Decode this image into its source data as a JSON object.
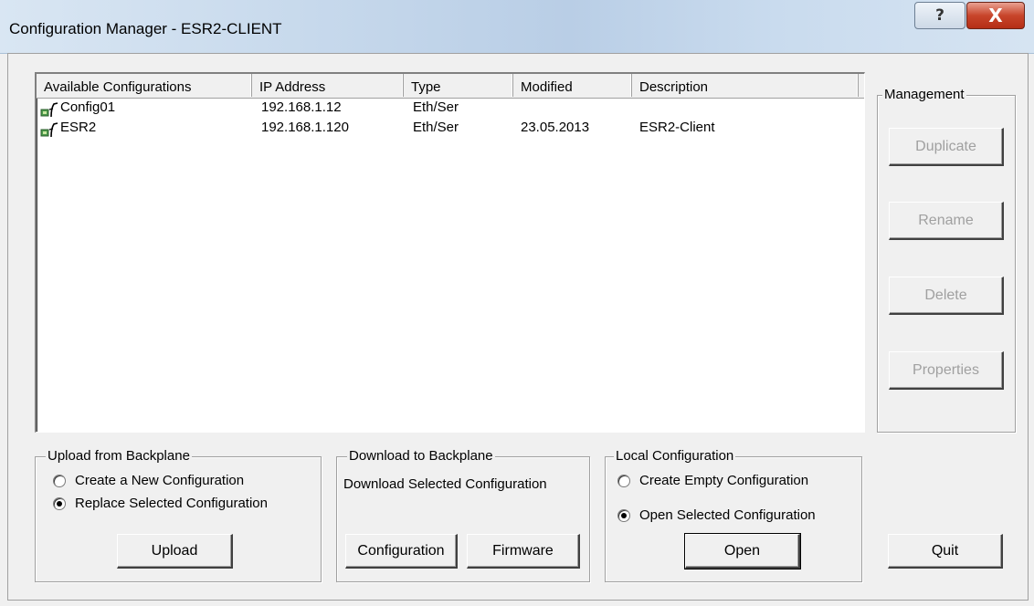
{
  "window": {
    "title": "Configuration Manager - ESR2-CLIENT",
    "help_label": "?",
    "close_label": "X"
  },
  "list": {
    "columns": [
      "Available Configurations",
      "IP Address",
      "Type",
      "Modified",
      "Description"
    ],
    "rows": [
      {
        "name": "Config01",
        "ip": "192.168.1.12",
        "type": "Eth/Ser",
        "modified": "",
        "description": ""
      },
      {
        "name": "ESR2",
        "ip": "192.168.1.120",
        "type": "Eth/Ser",
        "modified": "23.05.2013",
        "description": "ESR2-Client"
      }
    ]
  },
  "management": {
    "legend": "Management",
    "duplicate": "Duplicate",
    "rename": "Rename",
    "delete": "Delete",
    "properties": "Properties"
  },
  "upload": {
    "legend": "Upload from Backplane",
    "option_new": "Create a New Configuration",
    "option_replace": "Replace Selected Configuration",
    "button": "Upload"
  },
  "download": {
    "legend": "Download to Backplane",
    "text": "Download Selected Configuration",
    "config_button": "Configuration",
    "firmware_button": "Firmware"
  },
  "local": {
    "legend": "Local Configuration",
    "option_empty": "Create Empty Configuration",
    "option_open": "Open Selected Configuration",
    "button": "Open"
  },
  "quit": "Quit",
  "colors": {
    "titlebar": "#c7d9ec",
    "close": "#c8452b",
    "face": "#f0f0f0",
    "disabled_text": "#a0a0a0"
  }
}
